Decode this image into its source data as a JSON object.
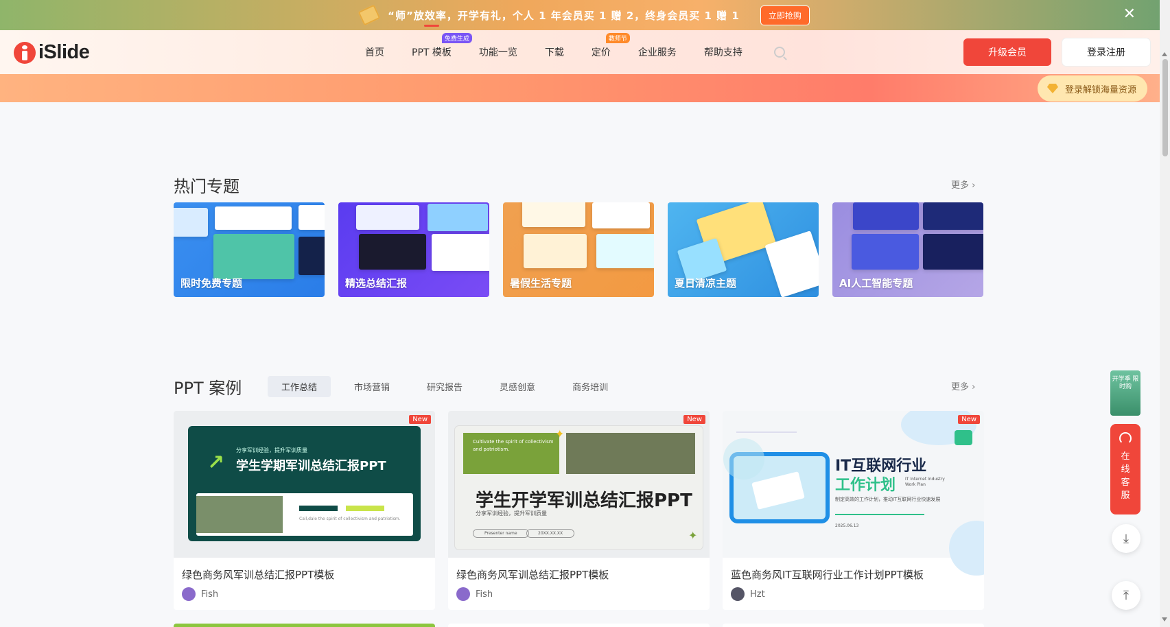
{
  "promo": {
    "text": "“师”放效率，开学有礼，个人 1 年会员买 1 赠 2，终身会员买 1 赠 1",
    "cta": "立即抢购",
    "close": "✕"
  },
  "header": {
    "logo": "iSlide",
    "nav": [
      {
        "label": "首页"
      },
      {
        "label": "PPT 模板",
        "tag": "免费生成"
      },
      {
        "label": "功能一览"
      },
      {
        "label": "下载"
      },
      {
        "label": "定价",
        "tag": "教师节"
      },
      {
        "label": "企业服务"
      },
      {
        "label": "帮助支持"
      }
    ],
    "upgrade": "升级会员",
    "login": "登录注册",
    "unlock": "登录解锁海量资源"
  },
  "hot_topics": {
    "title": "热门专题",
    "more": "更多",
    "items": [
      {
        "label": "限时免费专题"
      },
      {
        "label": "精选总结汇报"
      },
      {
        "label": "暑假生活专题"
      },
      {
        "label": "夏日清凉主题"
      },
      {
        "label": "AI人工智能专题"
      }
    ]
  },
  "cases": {
    "title": "PPT 案例",
    "more": "更多",
    "tabs": [
      "工作总结",
      "市场营销",
      "研究报告",
      "灵感创意",
      "商务培训"
    ],
    "active_tab": "工作总结",
    "cards": [
      {
        "badge": "New",
        "title": "绿色商务风军训总结汇报PPT模板",
        "author": "Fish",
        "thumb_sub": "分享军训经验，提升军训质量",
        "thumb_title": "学生学期军训总结汇报PPT",
        "thumb_note": "Call,dale the spirit of collectivism and patriotism."
      },
      {
        "badge": "New",
        "title": "绿色商务风军训总结汇报PPT模板",
        "author": "Fish",
        "thumb_en": "Cultivate the spirit of collectivism and patriotism.",
        "thumb_title": "学生开学军训总结汇报PPT",
        "thumb_sub": "分享军训经验，提升军训质量",
        "thumb_pill1": "Presenter name",
        "thumb_pill2": "20XX.XX.XX"
      },
      {
        "badge": "New",
        "title": "蓝色商务风IT互联网行业工作计划PPT模板",
        "author": "Hzt",
        "thumb_t1": "IT互联网行业",
        "thumb_t2": "工作计划",
        "thumb_en": "IT Internet Industry Work Plan",
        "thumb_sub": "制定高效的工作计划，推动IT互联网行业快速发展",
        "thumb_date": "2025.06.13"
      }
    ]
  },
  "side_tools": {
    "promo": "开学季 限时购",
    "cs": [
      "在",
      "线",
      "客",
      "服"
    ],
    "download_icon": "⤓",
    "top_icon": "⤒"
  },
  "colors": {
    "brand": "#f0463a",
    "accent_orange": "#ff8a2a"
  }
}
